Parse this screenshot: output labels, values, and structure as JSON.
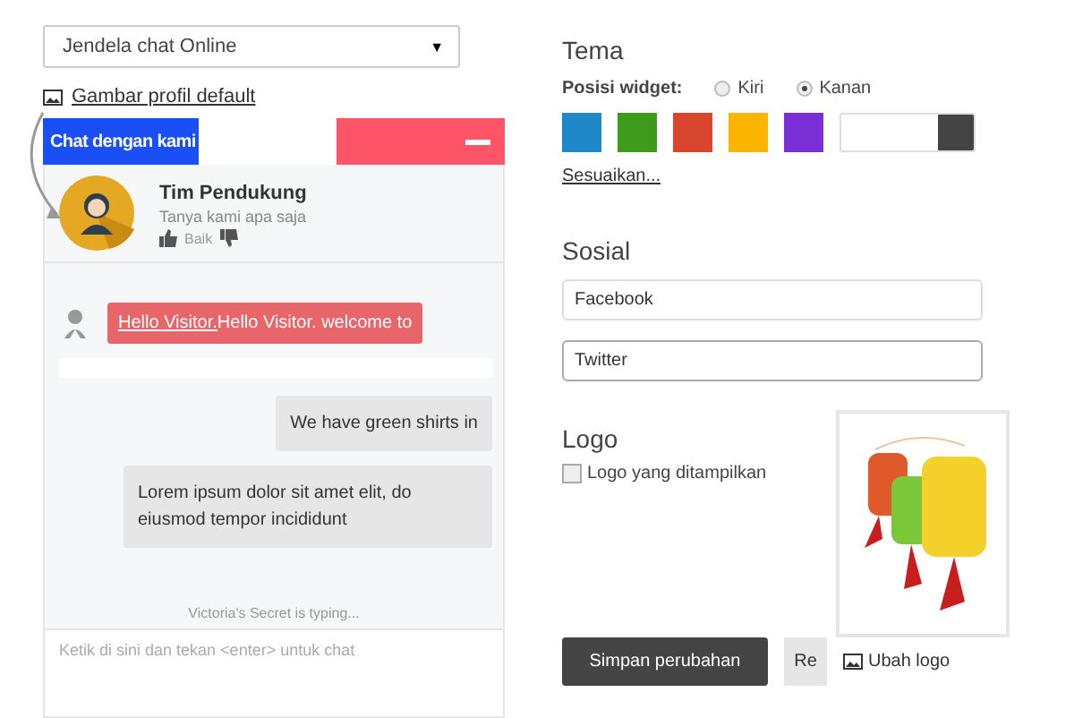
{
  "widget_select": {
    "value": "Jendela chat Online",
    "caret": "▼"
  },
  "profile_link": "Gambar profil default",
  "chat": {
    "header_title": "Chat dengan kami",
    "agent_name": "Tim Pendukung",
    "agent_subtitle": "Tanya kami apa saja",
    "rating_label": "Baik",
    "messages": [
      {
        "kind": "visitor",
        "link": "Hello Visitor.",
        "text": "Hello Visitor. welcome to"
      },
      {
        "kind": "agent",
        "text": "We have green shirts in"
      },
      {
        "kind": "agent",
        "text": "Lorem ipsum dolor sit amet elit, do eiusmod tempor incididunt"
      }
    ],
    "typing": "Victoria's Secret is typing...",
    "input_placeholder": "Ketik di sini dan tekan <enter> untuk chat"
  },
  "theme": {
    "heading": "Tema",
    "position_label": "Posisi widget:",
    "positions": [
      {
        "label": "Kiri",
        "selected": false
      },
      {
        "label": "Kanan",
        "selected": true
      }
    ],
    "swatches": [
      {
        "kind": "solid",
        "color": "#1e88c8"
      },
      {
        "kind": "solid",
        "color": "#3f9c1a"
      },
      {
        "kind": "solid",
        "color": "#d9452e"
      },
      {
        "kind": "solid",
        "color": "#fbb500"
      },
      {
        "kind": "solid",
        "color": "#7a2ed6"
      },
      {
        "kind": "split",
        "color": "#444444"
      }
    ],
    "custom_link": "Sesuaikan..."
  },
  "social": {
    "heading": "Sosial",
    "fields": [
      {
        "value": "Facebook",
        "focused": false
      },
      {
        "value": "Twitter",
        "focused": true
      }
    ]
  },
  "logo": {
    "heading": "Logo",
    "checkbox": {
      "label": "Logo yang ditampilkan",
      "checked": false
    },
    "change_link": "Ubah logo"
  },
  "buttons": {
    "save": "Simpan perubahan",
    "reset": "Re"
  }
}
